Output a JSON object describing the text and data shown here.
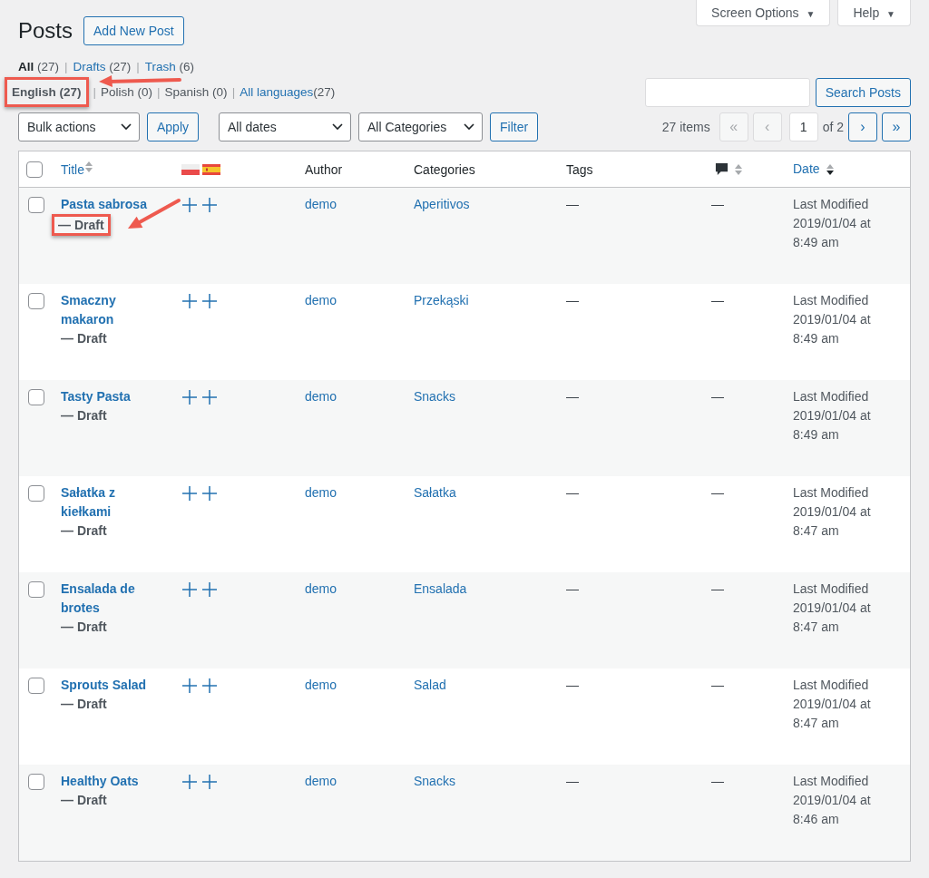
{
  "page_title": "Posts",
  "add_button": "Add New Post",
  "screen_meta": [
    {
      "label": "Screen Options",
      "caret": "▼"
    },
    {
      "label": "Help",
      "caret": "▼"
    }
  ],
  "separator": "|",
  "views": [
    {
      "label": "All",
      "count": "(27)",
      "selected": true
    },
    {
      "label": "Drafts",
      "count": "(27)",
      "selected": false
    },
    {
      "label": "Trash",
      "count": "(6)",
      "selected": false
    }
  ],
  "languages": [
    {
      "label": "English (27)",
      "kind": "current",
      "highlighted": true
    },
    {
      "label": "Polish (0)",
      "kind": "empty",
      "highlighted": false
    },
    {
      "label": "Spanish (0)",
      "kind": "empty",
      "highlighted": false
    },
    {
      "label": "All languages",
      "count": "(27)",
      "kind": "link",
      "highlighted": false
    }
  ],
  "search_button": "Search Posts",
  "bulk_select": "Bulk actions",
  "apply_button": "Apply",
  "date_select": "All dates",
  "category_select": "All Categories",
  "filter_button": "Filter",
  "pagination": {
    "items": "27 items",
    "first": {
      "label": "«",
      "disabled": true
    },
    "prev": {
      "label": "‹",
      "disabled": true
    },
    "page": "1",
    "of": "of 2",
    "next": {
      "label": "›",
      "disabled": false
    },
    "last": {
      "label": "»",
      "disabled": false
    }
  },
  "select_all_checked": false,
  "columns": [
    {
      "label": "Title",
      "kind": "text",
      "sortable": true,
      "sorted": false
    },
    {
      "kind": "flags"
    },
    {
      "label": "Author",
      "kind": "text",
      "sortable": false
    },
    {
      "label": "Categories",
      "kind": "text",
      "sortable": false
    },
    {
      "label": "Tags",
      "kind": "text",
      "sortable": false
    },
    {
      "kind": "comments",
      "sortable": true,
      "sorted": false
    },
    {
      "label": "Date",
      "kind": "text",
      "sortable": true,
      "sorted": true
    }
  ],
  "rows": [
    {
      "checked": false,
      "title": "Pasta sabrosa",
      "status": "— Draft",
      "status_highlighted": true,
      "author": "demo",
      "category": "Aperitivos",
      "tags": "—",
      "comments": "—",
      "date": "Last Modified 2019/01/04 at 8:49 am"
    },
    {
      "checked": false,
      "title": "Smaczny makaron",
      "status": "— Draft",
      "status_highlighted": false,
      "author": "demo",
      "category": "Przekąski",
      "tags": "—",
      "comments": "—",
      "date": "Last Modified 2019/01/04 at 8:49 am"
    },
    {
      "checked": false,
      "title": "Tasty Pasta",
      "status": "— Draft",
      "status_highlighted": false,
      "author": "demo",
      "category": "Snacks",
      "tags": "—",
      "comments": "—",
      "date": "Last Modified 2019/01/04 at 8:49 am"
    },
    {
      "checked": false,
      "title": "Sałatka z kiełkami",
      "status": "— Draft",
      "status_highlighted": false,
      "author": "demo",
      "category": "Sałatka",
      "tags": "—",
      "comments": "—",
      "date": "Last Modified 2019/01/04 at 8:47 am"
    },
    {
      "checked": false,
      "title": "Ensalada de brotes",
      "status": "— Draft",
      "status_highlighted": false,
      "author": "demo",
      "category": "Ensalada",
      "tags": "—",
      "comments": "—",
      "date": "Last Modified 2019/01/04 at 8:47 am"
    },
    {
      "checked": false,
      "title": "Sprouts Salad",
      "status": "— Draft",
      "status_highlighted": false,
      "author": "demo",
      "category": "Salad",
      "tags": "—",
      "comments": "—",
      "date": "Last Modified 2019/01/04 at 8:47 am"
    },
    {
      "checked": false,
      "title": "Healthy Oats",
      "status": "— Draft",
      "status_highlighted": false,
      "author": "demo",
      "category": "Snacks",
      "tags": "—",
      "comments": "—",
      "date": "Last Modified 2019/01/04 at 8:46 am"
    }
  ]
}
